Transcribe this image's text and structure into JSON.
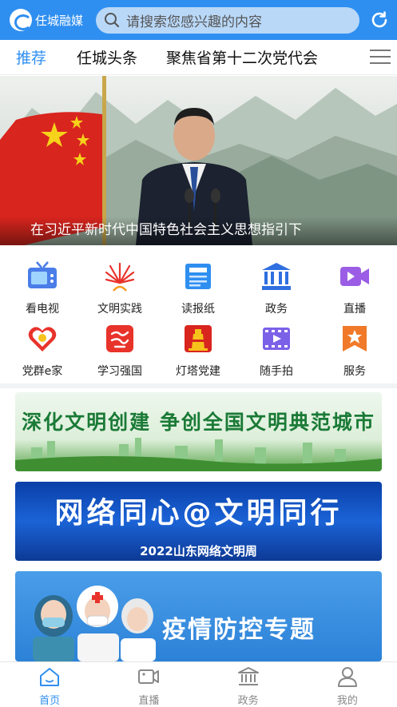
{
  "app": {
    "logo_text": "任城融媒"
  },
  "search": {
    "placeholder": "请搜索您感兴趣的内容"
  },
  "tabs": [
    {
      "label": "推荐",
      "active": true
    },
    {
      "label": "任城头条",
      "active": false
    },
    {
      "label": "聚焦省第十二次党代会",
      "active": false
    }
  ],
  "banner": {
    "caption": "在习近平新时代中国特色社会主义思想指引下"
  },
  "shortcuts": [
    {
      "label": "看电视",
      "icon": "tv-icon"
    },
    {
      "label": "文明实践",
      "icon": "civilization-icon"
    },
    {
      "label": "读报纸",
      "icon": "newspaper-icon"
    },
    {
      "label": "政务",
      "icon": "government-icon"
    },
    {
      "label": "直播",
      "icon": "live-video-icon"
    },
    {
      "label": "党群e家",
      "icon": "party-home-icon"
    },
    {
      "label": "学习强国",
      "icon": "xuexi-icon"
    },
    {
      "label": "灯塔党建",
      "icon": "lighthouse-icon"
    },
    {
      "label": "随手拍",
      "icon": "film-icon"
    },
    {
      "label": "服务",
      "icon": "service-icon"
    }
  ],
  "cards": {
    "card1": {
      "text": "深化文明创建  争创全国文明典范城市"
    },
    "card2": {
      "title": "网络同心@文明同行",
      "subtitle": "2022山东网络文明周"
    },
    "card3": {
      "title": "疫情防控专题"
    }
  },
  "bottom_nav": [
    {
      "label": "首页",
      "active": true,
      "icon": "home-icon"
    },
    {
      "label": "直播",
      "active": false,
      "icon": "camera-icon"
    },
    {
      "label": "政务",
      "active": false,
      "icon": "government-icon"
    },
    {
      "label": "我的",
      "active": false,
      "icon": "user-icon"
    }
  ],
  "colors": {
    "brand": "#2f8ff0",
    "red": "#e8332b"
  }
}
